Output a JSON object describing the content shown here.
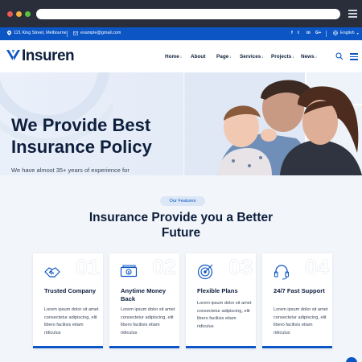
{
  "topbar": {
    "address": "121 King Street, Melbourne",
    "email": "example@gmail.com",
    "social": [
      "f",
      "t",
      "in",
      "G+"
    ],
    "language": "English"
  },
  "nav": {
    "logo": "Insuren",
    "links": [
      {
        "label": "Home",
        "has_caret": true
      },
      {
        "label": "About",
        "has_caret": false
      },
      {
        "label": "Page",
        "has_caret": true
      },
      {
        "label": "Services",
        "has_caret": true
      },
      {
        "label": "Projects",
        "has_caret": true
      },
      {
        "label": "News",
        "has_caret": true
      }
    ]
  },
  "hero": {
    "title": "We Provide Best Insurance Policy",
    "subtitle": "We have almost 35+ years of experience for"
  },
  "features": {
    "badge": "Our Features",
    "title": "Insurance Provide you a Better Future",
    "cards": [
      {
        "number": "01",
        "title": "Trusted Company",
        "body": "Lorem ipsum dolor sit amet consectetur adipiscing, elit libero facilisis etiam ridiculus",
        "icon": "handshake-icon"
      },
      {
        "number": "02",
        "title": "Anytime Money Back",
        "body": "Lorem ipsum dolor sit amet consectetur adipiscing, elit libero facilisis etiam ridiculus",
        "icon": "money-icon"
      },
      {
        "number": "03",
        "title": "Flexible Plans",
        "body": "Lorem ipsum dolor sit amet consectetur adipiscing, elit libero facilisis etiam ridiculus",
        "icon": "target-icon"
      },
      {
        "number": "04",
        "title": "24/7 Fast Support",
        "body": "Lorem ipsum dolor sit amet consectetur adipiscing, elit libero facilisis etiam ridiculus",
        "icon": "headset-icon"
      }
    ]
  },
  "colors": {
    "brand_blue": "#0b55c4",
    "navy": "#0e1f3d",
    "background": "#f2f5fa"
  }
}
